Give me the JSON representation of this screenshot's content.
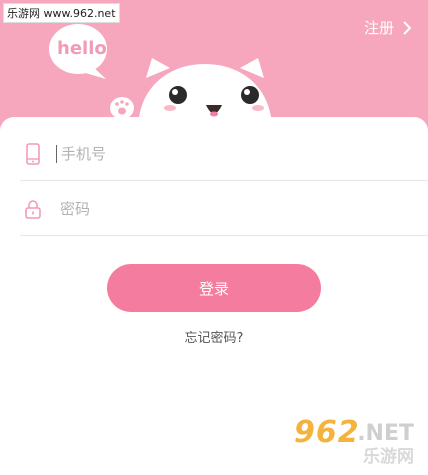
{
  "watermark_top": "乐游网 www.962.net",
  "header": {
    "register_label": "注册"
  },
  "mascot": {
    "bubble_text": "hello"
  },
  "form": {
    "phone_placeholder": "手机号",
    "password_placeholder": "密码"
  },
  "actions": {
    "login_label": "登录",
    "forgot_label": "忘记密码?"
  },
  "watermark_bottom": {
    "number": "962",
    "domain": ".NET",
    "name": "乐游网"
  },
  "colors": {
    "header_pink": "#f6a7be",
    "button_pink": "#f47c9f",
    "icon_pink": "#f19cb6"
  }
}
